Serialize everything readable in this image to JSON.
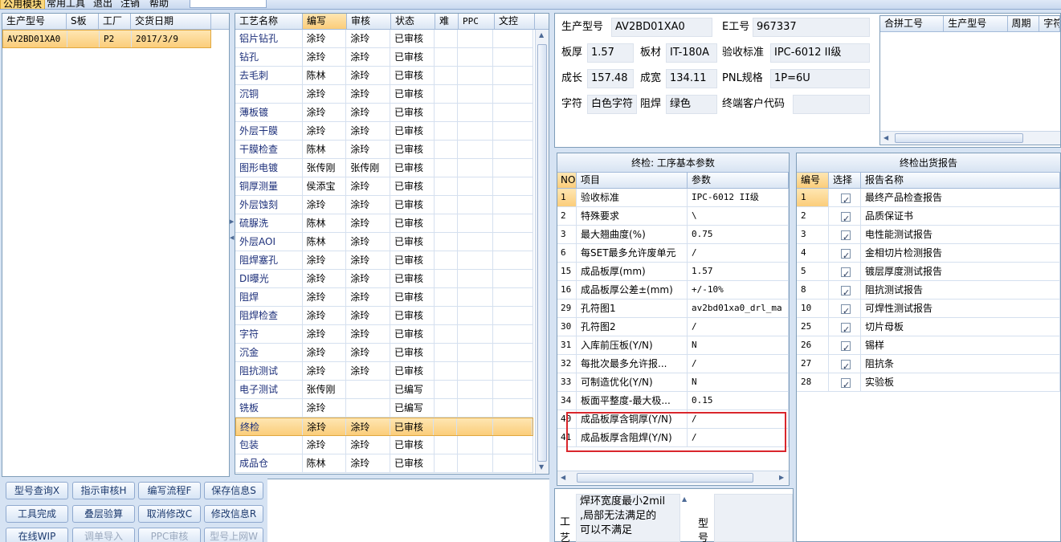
{
  "menu": {
    "items": [
      "公用模块",
      "常用工具",
      "退出",
      "注销",
      "帮助"
    ]
  },
  "order_table": {
    "columns": [
      "生产型号",
      "S板",
      "工厂",
      "交货日期"
    ],
    "rows": [
      {
        "model": "AV2BD01XA0",
        "s": "",
        "factory": "P2",
        "date": "2017/3/9"
      }
    ]
  },
  "process_table": {
    "columns": [
      "工艺名称",
      "编写",
      "审核",
      "状态",
      "难",
      "PPC",
      "文控"
    ],
    "rows": [
      {
        "name": "铝片钻孔",
        "writer": "涂玲",
        "reviewer": "涂玲",
        "status": "已审核"
      },
      {
        "name": "钻孔",
        "writer": "涂玲",
        "reviewer": "涂玲",
        "status": "已审核"
      },
      {
        "name": "去毛刺",
        "writer": "陈林",
        "reviewer": "涂玲",
        "status": "已审核"
      },
      {
        "name": "沉铜",
        "writer": "涂玲",
        "reviewer": "涂玲",
        "status": "已审核"
      },
      {
        "name": "薄板镀",
        "writer": "涂玲",
        "reviewer": "涂玲",
        "status": "已审核"
      },
      {
        "name": "外层干膜",
        "writer": "涂玲",
        "reviewer": "涂玲",
        "status": "已审核"
      },
      {
        "name": "干膜检查",
        "writer": "陈林",
        "reviewer": "涂玲",
        "status": "已审核"
      },
      {
        "name": "图形电镀",
        "writer": "张传刚",
        "reviewer": "张传刚",
        "status": "已审核"
      },
      {
        "name": "铜厚测量",
        "writer": "侯添宝",
        "reviewer": "涂玲",
        "status": "已审核"
      },
      {
        "name": "外层蚀刻",
        "writer": "涂玲",
        "reviewer": "涂玲",
        "status": "已审核"
      },
      {
        "name": "硫脲洗",
        "writer": "陈林",
        "reviewer": "涂玲",
        "status": "已审核"
      },
      {
        "name": "外层AOI",
        "writer": "陈林",
        "reviewer": "涂玲",
        "status": "已审核"
      },
      {
        "name": "阻焊塞孔",
        "writer": "涂玲",
        "reviewer": "涂玲",
        "status": "已审核"
      },
      {
        "name": "DI曝光",
        "writer": "涂玲",
        "reviewer": "涂玲",
        "status": "已审核"
      },
      {
        "name": "阻焊",
        "writer": "涂玲",
        "reviewer": "涂玲",
        "status": "已审核"
      },
      {
        "name": "阻焊检查",
        "writer": "涂玲",
        "reviewer": "涂玲",
        "status": "已审核"
      },
      {
        "name": "字符",
        "writer": "涂玲",
        "reviewer": "涂玲",
        "status": "已审核"
      },
      {
        "name": "沉金",
        "writer": "涂玲",
        "reviewer": "涂玲",
        "status": "已审核"
      },
      {
        "name": "阻抗测试",
        "writer": "涂玲",
        "reviewer": "涂玲",
        "status": "已审核"
      },
      {
        "name": "电子测试",
        "writer": "张传刚",
        "reviewer": "",
        "status": "已编写"
      },
      {
        "name": "铣板",
        "writer": "涂玲",
        "reviewer": "",
        "status": "已编写"
      },
      {
        "name": "终检",
        "writer": "涂玲",
        "reviewer": "涂玲",
        "status": "已审核",
        "selected": true
      },
      {
        "name": "包装",
        "writer": "涂玲",
        "reviewer": "涂玲",
        "status": "已审核"
      },
      {
        "name": "成品仓",
        "writer": "陈林",
        "reviewer": "涂玲",
        "status": "已审核"
      }
    ]
  },
  "buttons": [
    {
      "label": "型号查询X",
      "enabled": true
    },
    {
      "label": "指示审核H",
      "enabled": true
    },
    {
      "label": "编写流程F",
      "enabled": true
    },
    {
      "label": "保存信息S",
      "enabled": true
    },
    {
      "label": "工具完成",
      "enabled": true
    },
    {
      "label": "叠层验算",
      "enabled": true
    },
    {
      "label": "取消修改C",
      "enabled": true
    },
    {
      "label": "修改信息R",
      "enabled": true
    },
    {
      "label": "在线WIP",
      "enabled": true
    },
    {
      "label": "调单导入",
      "enabled": false
    },
    {
      "label": "PPC审核",
      "enabled": false
    },
    {
      "label": "型号上网W",
      "enabled": false
    }
  ],
  "info": {
    "model_label": "生产型号",
    "model_value": "AV2BD01XA0",
    "eno_label": "E工号",
    "eno_value": "967337",
    "thick_label": "板厚",
    "thick_value": "1.57",
    "material_label": "板材",
    "material_value": "IT-180A",
    "std_label": "验收标准",
    "std_value": "IPC-6012 II级",
    "len_label": "成长",
    "len_value": "157.48",
    "wid_label": "成宽",
    "wid_value": "134.11",
    "pnl_label": "PNL规格",
    "pnl_value": "1P=6U",
    "char_label": "字符",
    "char_value": "白色字符",
    "mask_label": "阻焊",
    "mask_value": "绿色",
    "client_label": "终端客户代码",
    "client_value": ""
  },
  "merge_table": {
    "columns": [
      "合拼工号",
      "生产型号",
      "周期",
      "字符"
    ]
  },
  "params": {
    "title": "终检: 工序基本参数",
    "columns": [
      "NO",
      "项目",
      "参数"
    ],
    "rows": [
      {
        "no": "1",
        "item": "验收标准",
        "value": "IPC-6012 II级"
      },
      {
        "no": "2",
        "item": "特殊要求",
        "value": "\\"
      },
      {
        "no": "3",
        "item": "最大翘曲度(%)",
        "value": "0.75"
      },
      {
        "no": "6",
        "item": "每SET最多允许废单元",
        "value": "/"
      },
      {
        "no": "15",
        "item": "成品板厚(mm)",
        "value": "1.57"
      },
      {
        "no": "16",
        "item": "成品板厚公差±(mm)",
        "value": "+/-10%"
      },
      {
        "no": "29",
        "item": "孔符图1",
        "value": "av2bd01xa0_drl_ma"
      },
      {
        "no": "30",
        "item": "孔符图2",
        "value": "/"
      },
      {
        "no": "31",
        "item": "入库前压板(Y/N)",
        "value": "N"
      },
      {
        "no": "32",
        "item": "每批次最多允许报...",
        "value": "/"
      },
      {
        "no": "33",
        "item": "可制造优化(Y/N)",
        "value": "N"
      },
      {
        "no": "34",
        "item": "板面平整度-最大极...",
        "value": "0.15"
      },
      {
        "no": "40",
        "item": "成品板厚含铜厚(Y/N)",
        "value": "/"
      },
      {
        "no": "41",
        "item": "成品板厚含阻焊(Y/N)",
        "value": "/"
      }
    ]
  },
  "reports": {
    "title": "终检出货报告",
    "columns": [
      "编号",
      "选择",
      "报告名称"
    ],
    "rows": [
      {
        "no": "1",
        "name": "最终产品检查报告"
      },
      {
        "no": "2",
        "name": "品质保证书"
      },
      {
        "no": "3",
        "name": "电性能测试报告"
      },
      {
        "no": "4",
        "name": "金相切片检测报告"
      },
      {
        "no": "5",
        "name": "镀层厚度测试报告"
      },
      {
        "no": "8",
        "name": "阻抗测试报告"
      },
      {
        "no": "10",
        "name": "可焊性测试报告"
      },
      {
        "no": "25",
        "name": "切片母板"
      },
      {
        "no": "26",
        "name": "锡样"
      },
      {
        "no": "27",
        "name": "阻抗条"
      },
      {
        "no": "28",
        "name": "实验板"
      }
    ]
  },
  "note": {
    "side_label_1": "工",
    "side_label_2": "艺",
    "text_line1": "焊环宽度最小2mil",
    "text_line2": ",局部无法满足的",
    "text_line3": "可以不满足",
    "right_label_1": "型",
    "right_label_2": "号"
  },
  "colors": {
    "highlight": "#d9262c",
    "selected_row": "#fbcd7a",
    "panel_bg": "#d6e3f3"
  }
}
